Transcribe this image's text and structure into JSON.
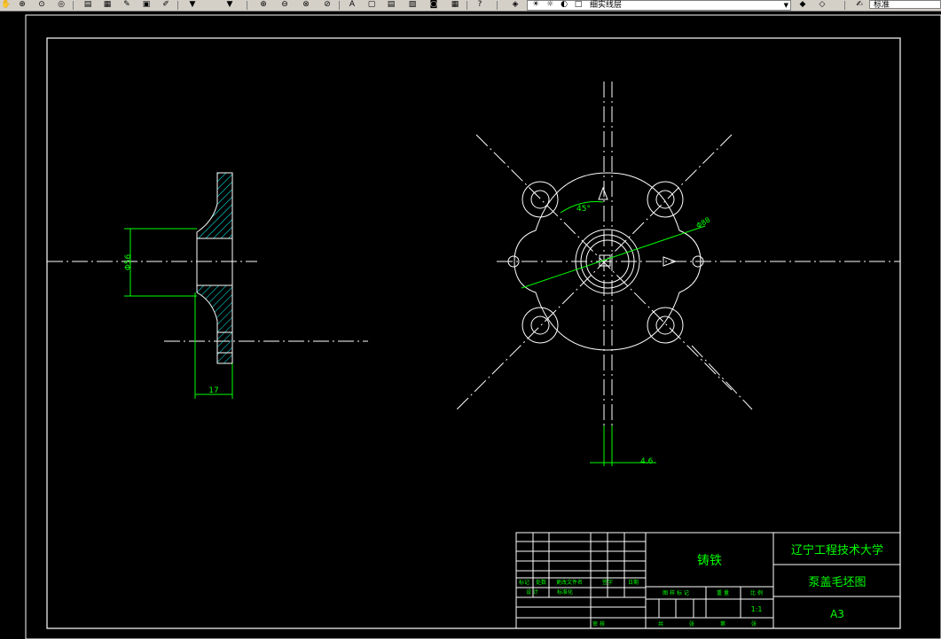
{
  "toolbar": {
    "layer_name": "细实线层",
    "text_style": "标准",
    "icons": [
      "pan-icon",
      "zoom-realtime-icon",
      "zoom-window-icon",
      "zoom-previous-icon",
      "properties-icon",
      "design-center-icon",
      "tool-palette-icon",
      "layer-manager-icon",
      "make-current-icon",
      "layer-previous-icon",
      "text-style-icon"
    ]
  },
  "dimensions": {
    "diameter_left": "Φ56",
    "thickness": "17",
    "angle": "45°",
    "diameter_circle": "Φ88",
    "offset": "4.6"
  },
  "title_block": {
    "material": "铸铁",
    "university": "辽宁工程技术大学",
    "drawing_name": "泵盖毛坯图",
    "size": "A3",
    "scale": "1:1",
    "row_labels": [
      "标记",
      "处数",
      "更改文件名",
      "签字",
      "日期"
    ],
    "row_labels2": [
      "设 计",
      "标准化"
    ],
    "stage_labels": [
      "图 样 标 记",
      "重 量",
      "比 例"
    ],
    "bottom_labels": [
      "审 核",
      "共",
      "张",
      "第",
      "张"
    ]
  },
  "colors": {
    "background": "#000000",
    "lines": "#ffffff",
    "dimensions": "#00ff00",
    "hatch": "#00ffff"
  }
}
